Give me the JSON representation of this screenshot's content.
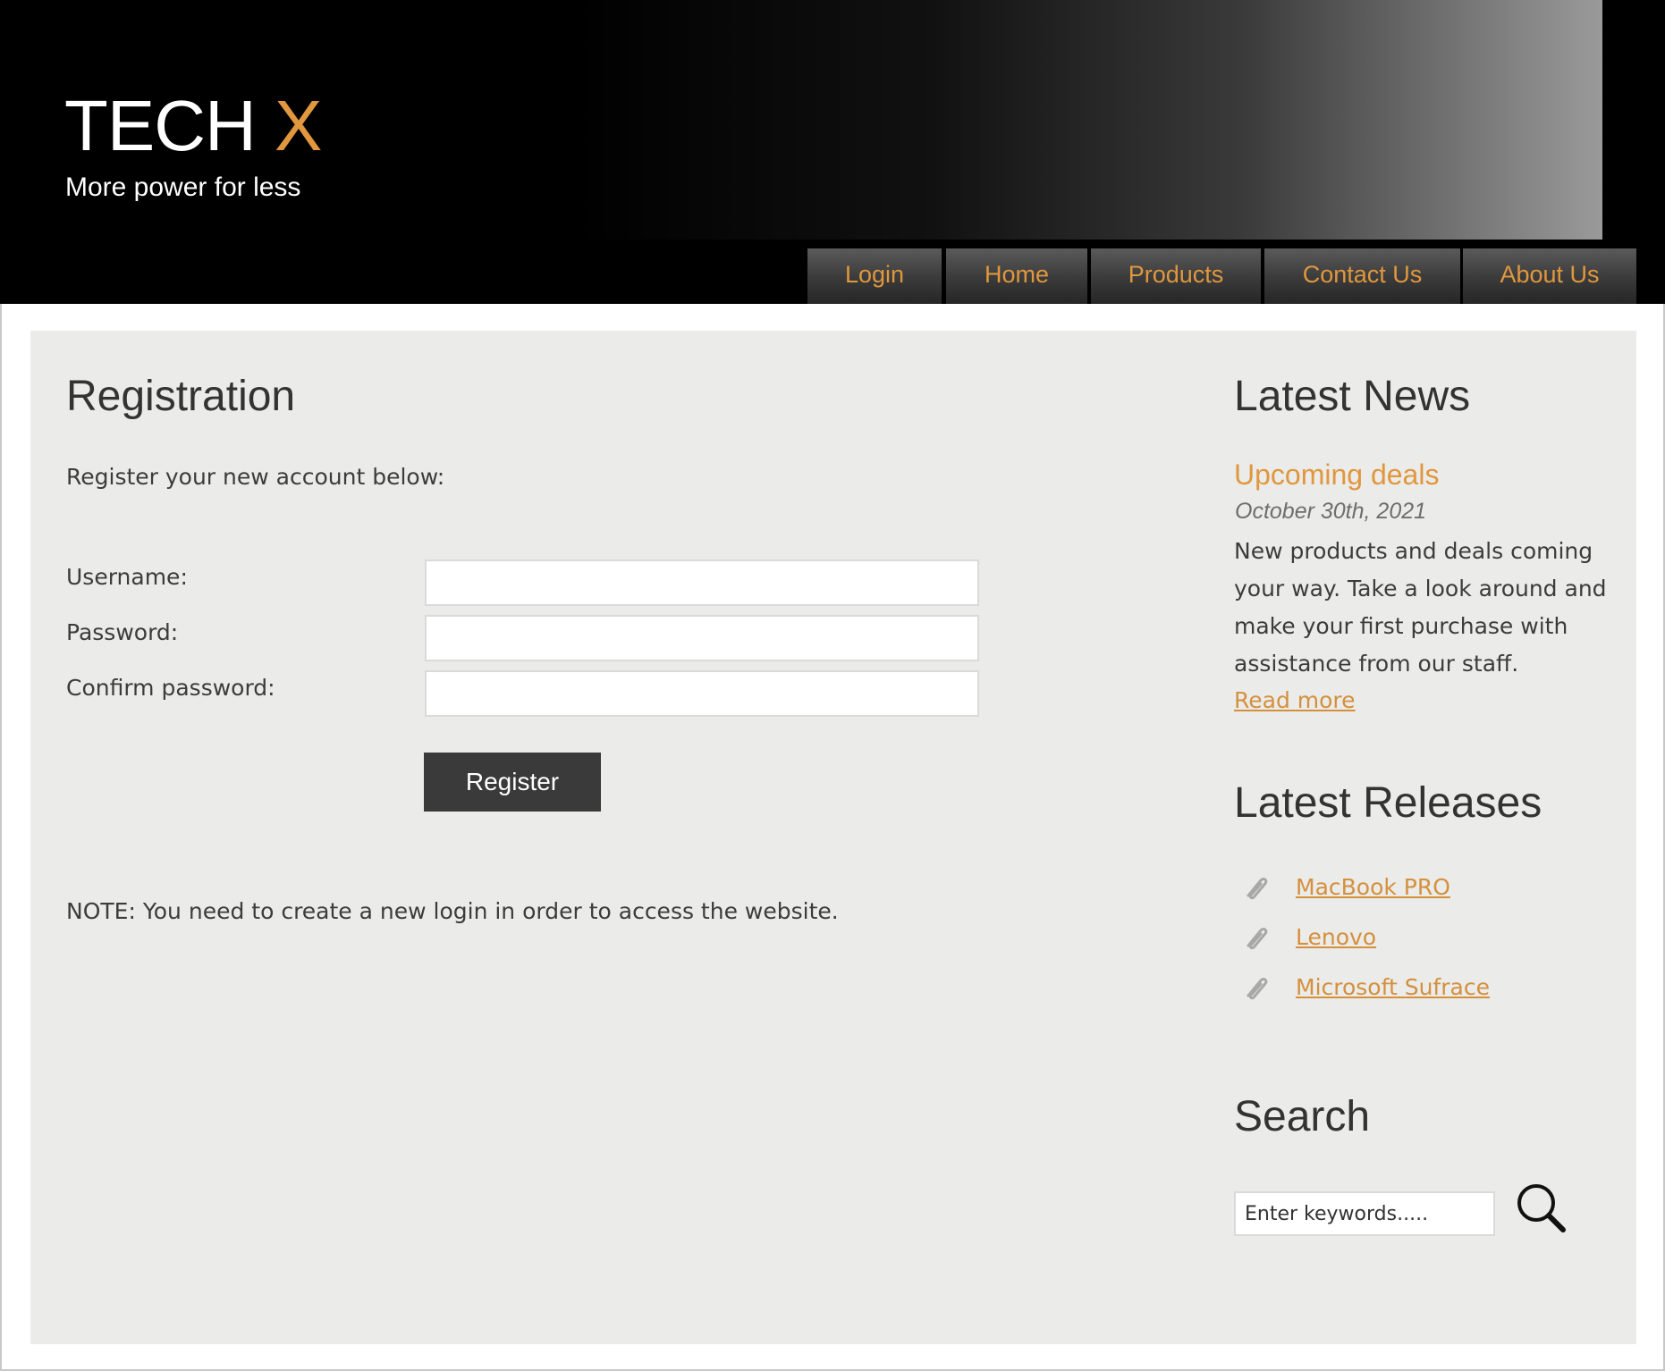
{
  "header": {
    "logo_main": "TECH ",
    "logo_accent": "X",
    "tagline": "More power for less"
  },
  "nav": {
    "items": [
      {
        "label": "Login"
      },
      {
        "label": "Home"
      },
      {
        "label": "Products"
      },
      {
        "label": "Contact Us"
      },
      {
        "label": "About Us"
      }
    ]
  },
  "registration": {
    "title": "Registration",
    "intro": "Register your new account below:",
    "username_label": "Username:",
    "username_value": "",
    "password_label": "Password:",
    "password_value": "",
    "confirm_label": "Confirm password:",
    "confirm_value": "",
    "register_button": "Register",
    "note": "NOTE: You need to create a new login in order to access the website."
  },
  "news": {
    "heading": "Latest News",
    "item_title": "Upcoming deals",
    "item_date": "October 30th, 2021",
    "item_body": "New products and deals coming your way. Take a look around and make your first purchase with assistance from our staff.",
    "read_more": "Read more"
  },
  "releases": {
    "heading": "Latest Releases",
    "items": [
      {
        "label": "MacBook PRO",
        "icon": "paperclip-icon"
      },
      {
        "label": "Lenovo",
        "icon": "paperclip-icon"
      },
      {
        "label": "Microsoft Sufrace",
        "icon": "paperclip-icon"
      }
    ]
  },
  "search": {
    "heading": "Search",
    "placeholder": "Enter keywords.....",
    "value": "",
    "icon": "magnifier-icon"
  },
  "colors": {
    "accent": "#e0973d",
    "link": "#d4903d",
    "header_bg": "#000000",
    "content_bg": "#ebebe9",
    "button_bg": "#3a3a3a"
  }
}
